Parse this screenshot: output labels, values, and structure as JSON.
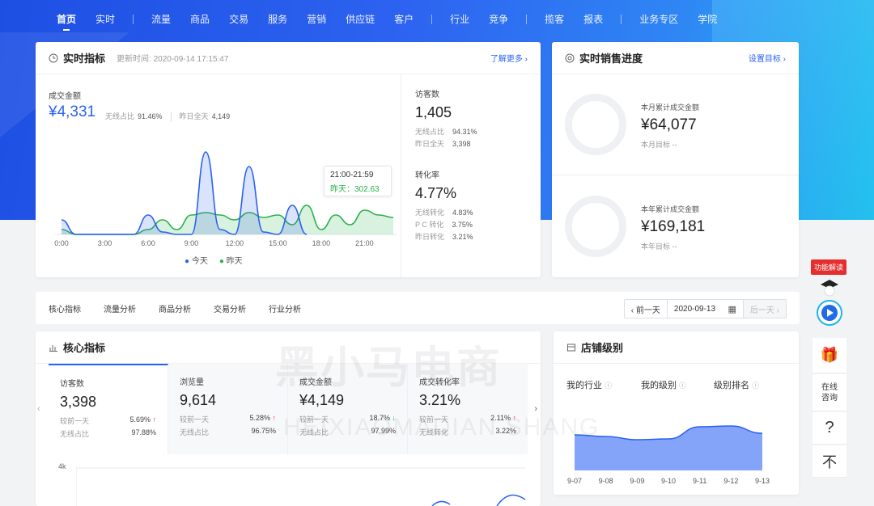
{
  "nav": {
    "items": [
      "首页",
      "实时",
      "流量",
      "商品",
      "交易",
      "服务",
      "营销",
      "供应链",
      "客户",
      "行业",
      "竞争",
      "揽客",
      "报表",
      "业务专区",
      "学院"
    ]
  },
  "realtime": {
    "title": "实时指标",
    "update_time": "更新时间: 2020-09-14 17:15:47",
    "more_link": "了解更多 ›",
    "gmv_label": "成交金额",
    "gmv_value": "¥4,331",
    "wireless_ratio_label": "无线占比",
    "wireless_ratio": "91.46%",
    "yesterday_label": "昨日全天",
    "yesterday_value": "4,149",
    "tooltip": {
      "time": "21:00-21:59",
      "value": "昨天：302.63"
    },
    "legend_today": "今天",
    "legend_yesterday": "昨天",
    "visitors_label": "访客数",
    "visitors_value": "1,405",
    "visitors_wireless_label": "无线占比",
    "visitors_wireless": "94.31%",
    "visitors_yesterday_label": "昨日全天",
    "visitors_yesterday": "3,398",
    "conv_label": "转化率",
    "conv_value": "4.77%",
    "conv_wireless_label": "无线转化",
    "conv_wireless": "4.83%",
    "conv_pc_label": "P C 转化",
    "conv_pc": "3.75%",
    "conv_yesterday_label": "昨日转化",
    "conv_yesterday": "3.21%"
  },
  "chart_data": {
    "type": "area",
    "x_ticks": [
      "0:00",
      "3:00",
      "6:00",
      "9:00",
      "12:00",
      "15:00",
      "18:00",
      "21:00"
    ],
    "x": [
      0,
      1,
      2,
      3,
      4,
      5,
      6,
      7,
      8,
      9,
      10,
      11,
      12,
      13,
      14,
      15,
      16,
      17,
      18,
      19,
      20,
      21,
      22,
      23
    ],
    "series": [
      {
        "name": "今天",
        "color": "#2a62f0",
        "values": [
          30,
          0,
          0,
          0,
          0,
          0,
          40,
          5,
          0,
          0,
          170,
          10,
          0,
          140,
          5,
          0,
          60,
          0,
          null,
          null,
          null,
          null,
          null,
          null
        ]
      },
      {
        "name": "昨天",
        "color": "#2bb24c",
        "values": [
          10,
          0,
          0,
          0,
          0,
          0,
          10,
          30,
          10,
          40,
          45,
          40,
          30,
          45,
          35,
          40,
          20,
          60,
          10,
          40,
          20,
          50,
          40,
          35
        ]
      }
    ],
    "ylim": [
      0,
      180
    ]
  },
  "sales": {
    "title": "实时销售进度",
    "set_target": "设置目标 ›",
    "month_label": "本月累计成交金额",
    "month_value": "¥64,077",
    "month_target": "本月目标 --",
    "year_label": "本年累计成交金额",
    "year_value": "¥169,181",
    "year_target": "本年目标 --"
  },
  "tabs": [
    "核心指标",
    "流量分析",
    "商品分析",
    "交易分析",
    "行业分析"
  ],
  "datebar": {
    "prev": "‹ 前一天",
    "date": "2020-09-13",
    "next": "后一天 ›"
  },
  "core": {
    "title": "核心指标",
    "y_tick": "4k",
    "metrics": [
      {
        "label": "访客数",
        "value": "3,398",
        "cmp_label": "较前一天",
        "cmp": "5.69%",
        "dir": "↑",
        "ratio_label": "无线占比",
        "ratio": "97.88%"
      },
      {
        "label": "浏览量",
        "value": "9,614",
        "cmp_label": "较前一天",
        "cmp": "5.28%",
        "dir": "↑",
        "ratio_label": "无线占比",
        "ratio": "96.75%"
      },
      {
        "label": "成交金额",
        "value": "¥4,149",
        "cmp_label": "较前一天",
        "cmp": "18.7%",
        "dir": "↓",
        "ratio_label": "无线占比",
        "ratio": "97.99%"
      },
      {
        "label": "成交转化率",
        "value": "3.21%",
        "cmp_label": "较前一天",
        "cmp": "2.11%",
        "dir": "↑",
        "ratio_label": "无线转化",
        "ratio": "3.22%"
      }
    ]
  },
  "shop": {
    "title": "店铺级别",
    "col1": "我的行业",
    "col2": "我的级别",
    "col3": "级别排名",
    "x_ticks": [
      "9-07",
      "9-08",
      "9-09",
      "9-10",
      "9-11",
      "9-12",
      "9-13"
    ]
  },
  "tools": {
    "badge": "功能解读",
    "consult": "在线\n咨询",
    "help": "?",
    "top": "不"
  },
  "watermark": {
    "cn": "黑小马电商",
    "en": "HEIXIAOMADIAN SHANG"
  }
}
